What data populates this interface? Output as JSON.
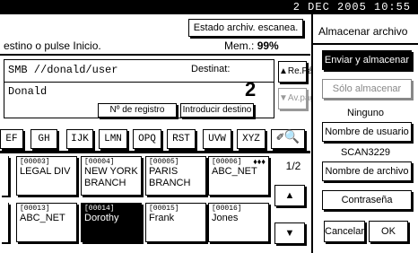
{
  "header": {
    "clock": "2 DEC  2005 10:55"
  },
  "status": {
    "estado_btn": "Estado archiv. escanea.",
    "message": "estino o pulse Inicio.",
    "mem_label": "Mem.:",
    "mem_value": "99%"
  },
  "dest": {
    "path": "SMB //donald/user",
    "destinat_label": "Destinat:",
    "count": "2",
    "user": "Donald",
    "registro_btn": "Nº de registro",
    "intro_btn": "Introducir destino",
    "prev_page": "▲Re.Pág",
    "next_page": "▼Av.pág"
  },
  "tabs": [
    "EF",
    "GH",
    "IJK",
    "LMN",
    "OPQ",
    "RST",
    "UVW",
    "XYZ",
    "✐🔍"
  ],
  "entries_row1": [
    {
      "code": "[00003]",
      "name": "LEGAL DIV"
    },
    {
      "code": "[00004]",
      "name": "NEW YORK BRANCH"
    },
    {
      "code": "[00005]",
      "name": "PARIS BRANCH"
    },
    {
      "code": "[00006]",
      "name": "ABC_NET",
      "group": "♦♦♦"
    }
  ],
  "entries_row2": [
    {
      "code": "[00013]",
      "name": "ABC_NET"
    },
    {
      "code": "[00014]",
      "name": "Dorothy"
    },
    {
      "code": "[00015]",
      "name": "Frank"
    },
    {
      "code": "[00016]",
      "name": "Jones"
    }
  ],
  "pager": {
    "label": "1/2",
    "up": "▲",
    "down": "▼"
  },
  "side": {
    "title": "Almacenar archivo",
    "store_send": "Enviar y almacenar",
    "store_only": "Sólo almacenar",
    "none_label": "Ninguno",
    "user_name_btn": "Nombre de usuario",
    "scan_label": "SCAN3229",
    "file_name_btn": "Nombre de archivo",
    "password_btn": "Contraseña",
    "cancel": "Cancelar",
    "ok": "OK"
  }
}
